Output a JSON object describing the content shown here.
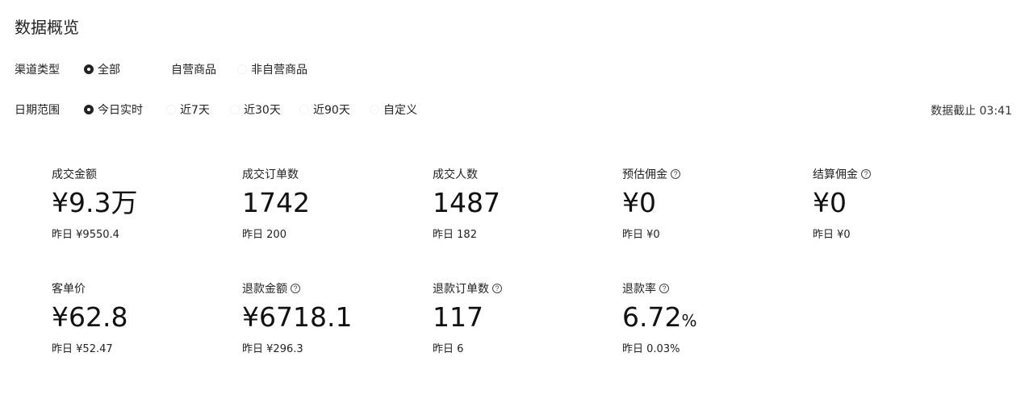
{
  "page": {
    "title": "数据概览"
  },
  "filters": {
    "channel": {
      "label": "渠道类型",
      "options": [
        {
          "label": "全部",
          "selected": true
        },
        {
          "label": "自营商品",
          "selected": false
        },
        {
          "label": "非自营商品",
          "selected": false
        }
      ]
    },
    "date": {
      "label": "日期范围",
      "options": [
        {
          "label": "今日实时",
          "selected": true
        },
        {
          "label": "近7天",
          "selected": false
        },
        {
          "label": "近30天",
          "selected": false
        },
        {
          "label": "近90天",
          "selected": false
        },
        {
          "label": "自定义",
          "selected": false
        }
      ]
    },
    "deadline": "数据截止 03:41"
  },
  "metrics": [
    {
      "label": "成交金额",
      "value": "¥9.3万",
      "prev_prefix": "昨日",
      "prev": "¥9550.4",
      "has_help": false
    },
    {
      "label": "成交订单数",
      "value": "1742",
      "prev_prefix": "昨日",
      "prev": "200",
      "has_help": false
    },
    {
      "label": "成交人数",
      "value": "1487",
      "prev_prefix": "昨日",
      "prev": "182",
      "has_help": false
    },
    {
      "label": "预估佣金",
      "value": "¥0",
      "prev_prefix": "昨日",
      "prev": "¥0",
      "has_help": true
    },
    {
      "label": "结算佣金",
      "value": "¥0",
      "prev_prefix": "昨日",
      "prev": "¥0",
      "has_help": true
    },
    {
      "label": "客单价",
      "value": "¥62.8",
      "prev_prefix": "昨日",
      "prev": "¥52.47",
      "has_help": false
    },
    {
      "label": "退款金额",
      "value": "¥6718.1",
      "prev_prefix": "昨日",
      "prev": "¥296.3",
      "has_help": true
    },
    {
      "label": "退款订单数",
      "value": "117",
      "prev_prefix": "昨日",
      "prev": "6",
      "has_help": true
    },
    {
      "label": "退款率",
      "value": "6.72",
      "value_unit": "%",
      "prev_prefix": "昨日",
      "prev": "0.03%",
      "has_help": true
    }
  ],
  "icons": {
    "help": "question-circle-icon",
    "help_glyph": "?"
  }
}
